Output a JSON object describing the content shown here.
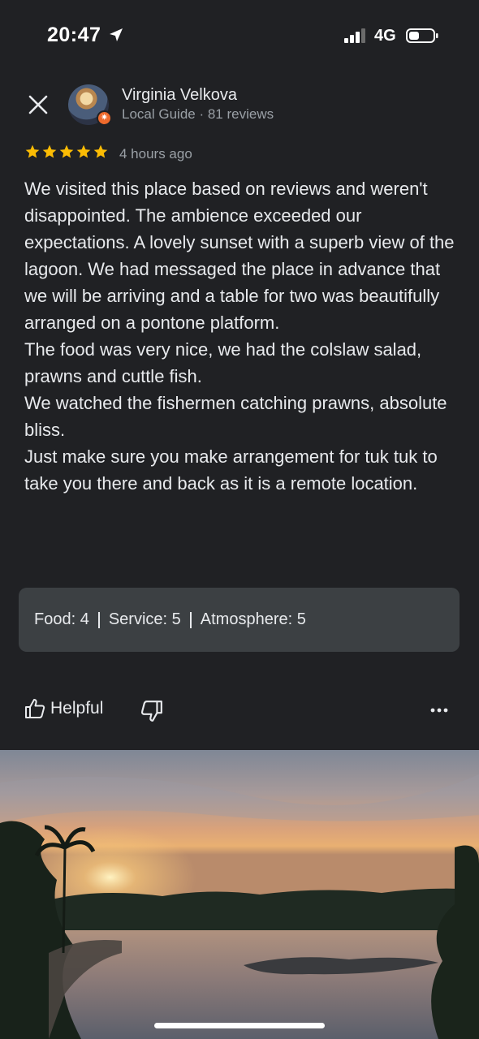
{
  "status_bar": {
    "time": "20:47",
    "network": "4G",
    "signal_bars": 3,
    "battery_level": 0.35
  },
  "review": {
    "reviewer": {
      "name": "Virginia Velkova",
      "meta": "Local Guide · 81 reviews"
    },
    "rating": 5,
    "time_ago": "4 hours ago",
    "paragraphs": [
      "We visited this place based on reviews and weren't disappointed. The ambience exceeded our expectations. A lovely sunset with a superb view of the lagoon. We had messaged the place in advance that we will be arriving and a table for two was beautifully arranged on a pontone platform.",
      "The food was very nice, we had the colslaw salad, prawns and cuttle fish.",
      "We watched the fishermen catching prawns, absolute bliss.",
      "Just make sure you make arrangement for tuk tuk to take you there and back as it is a remote location."
    ],
    "sub_ratings": [
      {
        "label": "Food: 4"
      },
      {
        "label": "Service: 5"
      },
      {
        "label": "Atmosphere: 5"
      }
    ]
  },
  "actions": {
    "helpful_label": "Helpful"
  },
  "icons": {
    "close": "close-icon",
    "thumbs_up": "thumbs-up-icon",
    "thumbs_down": "thumbs-down-icon",
    "more": "more-horizontal-icon",
    "location": "location-arrow-icon",
    "star": "star-icon"
  },
  "colors": {
    "star": "#fbbc04",
    "badge": "#ee6a2c",
    "card_bg": "#3c4043",
    "bg": "#202124"
  }
}
